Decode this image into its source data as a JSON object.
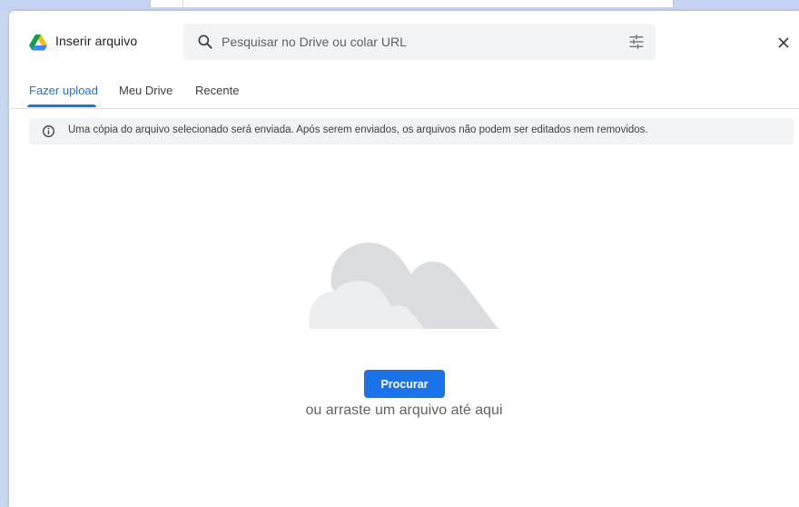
{
  "header": {
    "title": "Inserir arquivo",
    "logo_icon": "google-drive-logo",
    "close_icon": "close-icon"
  },
  "search": {
    "placeholder": "Pesquisar no Drive ou colar URL",
    "value": "",
    "icon": "search-icon",
    "filter_icon": "tune-icon"
  },
  "tabs": [
    {
      "label": "Fazer upload",
      "active": true
    },
    {
      "label": "Meu Drive",
      "active": false
    },
    {
      "label": "Recente",
      "active": false
    }
  ],
  "notice": {
    "icon": "info-icon",
    "text": "Uma cópia do arquivo selecionado será enviada. Após serem enviados, os arquivos não podem ser editados nem removidos."
  },
  "upload": {
    "illustration": "cloud-illustration",
    "button_label": "Procurar",
    "drop_text": "ou arraste um arquivo até aqui"
  },
  "colors": {
    "accent": "#1a73e8",
    "text": "#202124",
    "muted": "#5f6368",
    "surface": "#f1f3f4",
    "backdrop": "#c9d6f2"
  }
}
